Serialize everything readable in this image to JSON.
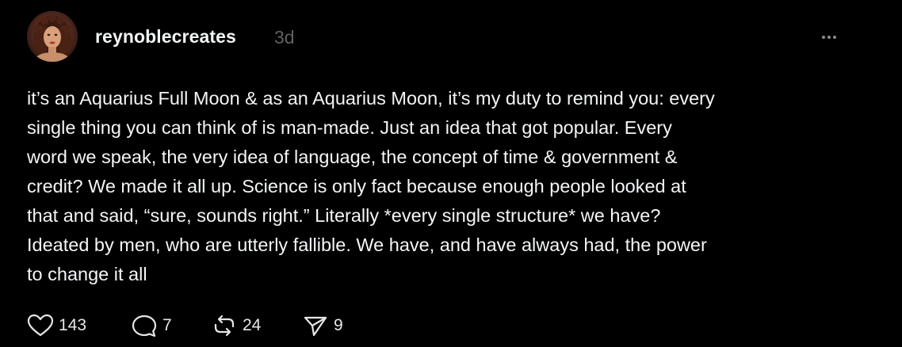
{
  "post": {
    "username": "reynoblecreates",
    "timestamp": "3d",
    "text": "it’s an Aquarius Full Moon & as an Aquarius Moon, it’s my duty to remind you: every\nsingle thing you can think of is man-made. Just an idea that got popular. Every\nword we speak, the very idea of language, the concept of time & government &\ncredit? We made it all up. Science is only fact because enough people looked at\nthat and said, “sure, sounds right.” Literally *every single structure* we have?\nIdeated by men, who are utterly fallible. We have, and have always had, the power\nto change it all",
    "avatar_icon": "profile-photo"
  },
  "actions": {
    "likes": "143",
    "replies": "7",
    "reposts": "24",
    "shares": "9",
    "like_icon": "heart-icon",
    "reply_icon": "comment-bubble-icon",
    "repost_icon": "repost-arrows-icon",
    "share_icon": "paper-plane-icon",
    "more_icon": "ellipsis-icon"
  },
  "colors": {
    "background": "#000000",
    "text": "#f3f5f7",
    "muted": "#616161"
  }
}
